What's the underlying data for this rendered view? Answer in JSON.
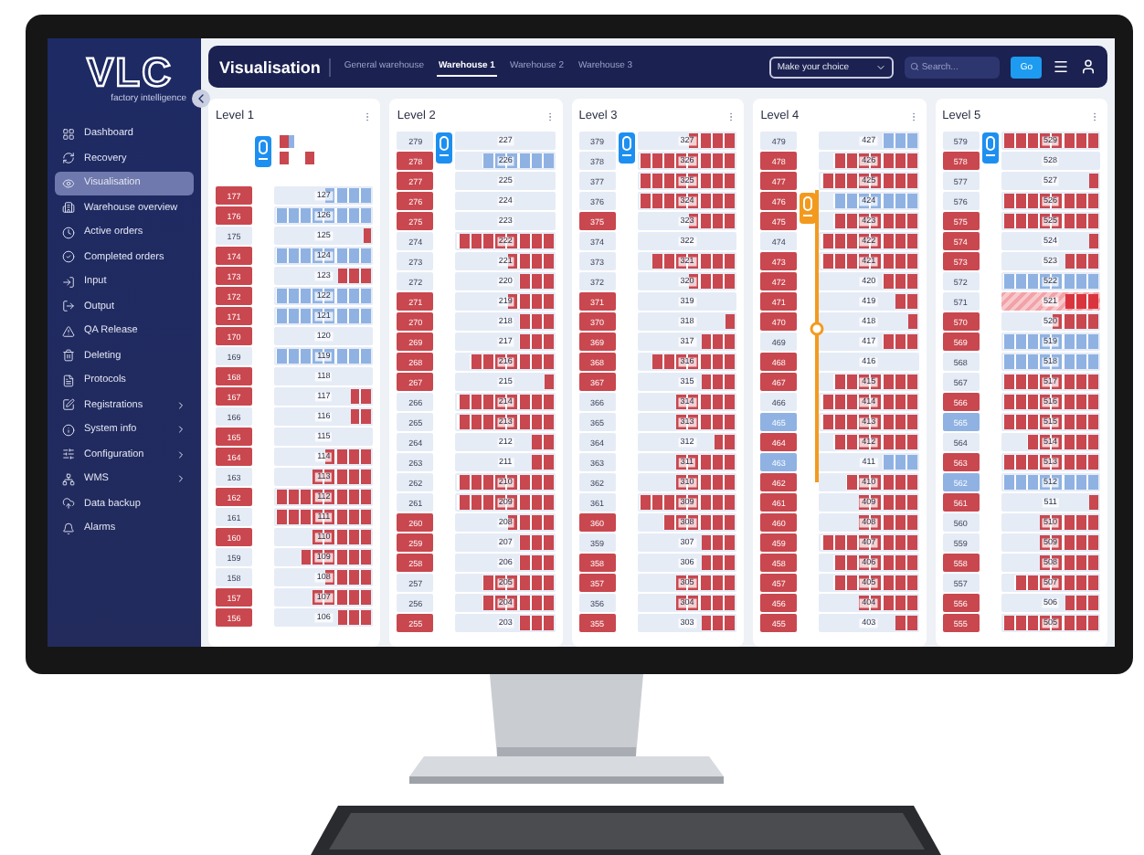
{
  "logo": {
    "name": "VLC",
    "tagline": "factory intelligence"
  },
  "sidebar": {
    "items": [
      {
        "label": "Dashboard",
        "selected": false,
        "submenu": false
      },
      {
        "label": "Recovery",
        "selected": false,
        "submenu": false
      },
      {
        "label": "Visualisation",
        "selected": true,
        "submenu": false
      },
      {
        "label": "Warehouse overview",
        "selected": false,
        "submenu": false
      },
      {
        "label": "Active orders",
        "selected": false,
        "submenu": false
      },
      {
        "label": "Completed orders",
        "selected": false,
        "submenu": false
      },
      {
        "label": "Input",
        "selected": false,
        "submenu": false
      },
      {
        "label": "Output",
        "selected": false,
        "submenu": false
      },
      {
        "label": "QA Release",
        "selected": false,
        "submenu": false
      },
      {
        "label": "Deleting",
        "selected": false,
        "submenu": false
      },
      {
        "label": "Protocols",
        "selected": false,
        "submenu": false
      },
      {
        "label": "Registrations",
        "selected": false,
        "submenu": true
      },
      {
        "label": "System info",
        "selected": false,
        "submenu": true
      },
      {
        "label": "Configuration",
        "selected": false,
        "submenu": true
      },
      {
        "label": "WMS",
        "selected": false,
        "submenu": true
      },
      {
        "label": "Data backup",
        "selected": false,
        "submenu": false
      },
      {
        "label": "Alarms",
        "selected": false,
        "submenu": false
      }
    ]
  },
  "header": {
    "title": "Visualisation",
    "tabs": [
      {
        "label": "General warehouse",
        "selected": false
      },
      {
        "label": "Warehouse 1",
        "selected": true
      },
      {
        "label": "Warehouse 2",
        "selected": false
      },
      {
        "label": "Warehouse 3",
        "selected": false
      }
    ],
    "select": {
      "placeholder": "Make your choice"
    },
    "search": {
      "placeholder": "Search..."
    },
    "go": "Go"
  },
  "levels": [
    {
      "title": "Level 1",
      "buffer": true,
      "lift": {
        "color": "#1d8ff0"
      },
      "track": false,
      "rows": [
        {
          "side": {
            "label": "177",
            "color": "#c9474f"
          },
          "bay": "127",
          "color": "#8fb2e3",
          "level": 0.5
        },
        {
          "side": {
            "label": "176",
            "color": "#c9474f"
          },
          "bay": "126",
          "color": "#8fb2e3",
          "level": 1
        },
        {
          "side": {
            "label": "175"
          },
          "bay": "125",
          "color": "#c9474f",
          "level": 0.125
        },
        {
          "side": {
            "label": "174",
            "color": "#c9474f"
          },
          "bay": "124",
          "color": "#8fb2e3",
          "level": 1
        },
        {
          "side": {
            "label": "173",
            "color": "#c9474f"
          },
          "bay": "123",
          "color": "#c9474f",
          "level": 0.375
        },
        {
          "side": {
            "label": "172",
            "color": "#c9474f"
          },
          "bay": "122",
          "color": "#8fb2e3",
          "level": 1
        },
        {
          "side": {
            "label": "171",
            "color": "#c9474f"
          },
          "bay": "121",
          "color": "#8fb2e3",
          "level": 1
        },
        {
          "side": {
            "label": "170",
            "color": "#c9474f"
          },
          "bay": "120"
        },
        {
          "side": {
            "label": "169"
          },
          "bay": "119",
          "color": "#8fb2e3",
          "level": 1
        },
        {
          "side": {
            "label": "168",
            "color": "#c9474f"
          },
          "bay": "118"
        },
        {
          "side": {
            "label": "167",
            "color": "#c9474f"
          },
          "bay": "117",
          "color": "#c9474f",
          "level": 0.25
        },
        {
          "side": {
            "label": "166"
          },
          "bay": "116",
          "color": "#c9474f",
          "level": 0.25
        },
        {
          "side": {
            "label": "165",
            "color": "#c9474f"
          },
          "bay": "115"
        },
        {
          "side": {
            "label": "164",
            "color": "#c9474f"
          },
          "bay": "114",
          "color": "#c9474f",
          "level": 0.5
        },
        {
          "side": {
            "label": "163"
          },
          "bay": "113",
          "color": "#c9474f",
          "level": 0.625
        },
        {
          "side": {
            "label": "162",
            "color": "#c9474f"
          },
          "bay": "112",
          "color": "#c9474f",
          "level": 1
        },
        {
          "side": {
            "label": "161"
          },
          "bay": "111",
          "color": "#c9474f",
          "level": 1
        },
        {
          "side": {
            "label": "160",
            "color": "#c9474f"
          },
          "bay": "110",
          "color": "#c9474f",
          "level": 0.625
        },
        {
          "side": {
            "label": "159"
          },
          "bay": "109",
          "color": "#c9474f",
          "level": 0.75
        },
        {
          "side": {
            "label": "158"
          },
          "bay": "108",
          "color": "#c9474f",
          "level": 0.5
        },
        {
          "side": {
            "label": "157",
            "color": "#c9474f"
          },
          "bay": "107",
          "color": "#c9474f",
          "level": 0.625
        },
        {
          "side": {
            "label": "156",
            "color": "#c9474f"
          },
          "bay": "106",
          "color": "#c9474f",
          "level": 0.375
        }
      ]
    },
    {
      "title": "Level 2",
      "buffer": false,
      "track": false,
      "rows": [
        {
          "side": {
            "label": "279"
          },
          "bay": "227",
          "lift": {
            "color": "#1d8ff0"
          }
        },
        {
          "side": {
            "label": "278",
            "color": "#c9474f"
          },
          "bay": "226",
          "color": "#8fb2e3",
          "level": 0.75
        },
        {
          "side": {
            "label": "277",
            "color": "#c9474f"
          },
          "bay": "225"
        },
        {
          "side": {
            "label": "276",
            "color": "#c9474f"
          },
          "bay": "224"
        },
        {
          "side": {
            "label": "275",
            "color": "#c9474f"
          },
          "bay": "223"
        },
        {
          "side": {
            "label": "274"
          },
          "bay": "222",
          "color": "#c9474f",
          "level": 1
        },
        {
          "side": {
            "label": "273"
          },
          "bay": "221",
          "color": "#c9474f",
          "level": 0.5
        },
        {
          "side": {
            "label": "272"
          },
          "bay": "220",
          "color": "#c9474f",
          "level": 0.375
        },
        {
          "side": {
            "label": "271",
            "color": "#c9474f"
          },
          "bay": "219",
          "color": "#c9474f",
          "level": 0.5
        },
        {
          "side": {
            "label": "270",
            "color": "#c9474f"
          },
          "bay": "218",
          "color": "#c9474f",
          "level": 0.375
        },
        {
          "side": {
            "label": "269",
            "color": "#c9474f"
          },
          "bay": "217",
          "color": "#c9474f",
          "level": 0.375
        },
        {
          "side": {
            "label": "268",
            "color": "#c9474f"
          },
          "bay": "216",
          "color": "#c9474f",
          "level": 0.875
        },
        {
          "side": {
            "label": "267",
            "color": "#c9474f"
          },
          "bay": "215",
          "color": "#c9474f",
          "level": 0.125
        },
        {
          "side": {
            "label": "266"
          },
          "bay": "214",
          "color": "#c9474f",
          "level": 1
        },
        {
          "side": {
            "label": "265"
          },
          "bay": "213",
          "color": "#c9474f",
          "level": 1
        },
        {
          "side": {
            "label": "264"
          },
          "bay": "212",
          "color": "#c9474f",
          "level": 0.25
        },
        {
          "side": {
            "label": "263"
          },
          "bay": "211",
          "color": "#c9474f",
          "level": 0.25
        },
        {
          "side": {
            "label": "262"
          },
          "bay": "210",
          "color": "#c9474f",
          "level": 1
        },
        {
          "side": {
            "label": "261"
          },
          "bay": "209",
          "color": "#c9474f",
          "level": 1
        },
        {
          "side": {
            "label": "260",
            "color": "#c9474f"
          },
          "bay": "208",
          "color": "#c9474f",
          "level": 0.5
        },
        {
          "side": {
            "label": "259",
            "color": "#c9474f"
          },
          "bay": "207",
          "color": "#c9474f",
          "level": 0.375
        },
        {
          "side": {
            "label": "258",
            "color": "#c9474f"
          },
          "bay": "206",
          "color": "#c9474f",
          "level": 0.375
        },
        {
          "side": {
            "label": "257"
          },
          "bay": "205",
          "color": "#c9474f",
          "level": 0.75
        },
        {
          "side": {
            "label": "256"
          },
          "bay": "204",
          "color": "#c9474f",
          "level": 0.75
        },
        {
          "side": {
            "label": "255",
            "color": "#c9474f"
          },
          "bay": "203",
          "color": "#c9474f",
          "level": 0.375
        }
      ]
    },
    {
      "title": "Level 3",
      "buffer": false,
      "track": false,
      "rows": [
        {
          "side": {
            "label": "379"
          },
          "bay": "327",
          "color": "#c9474f",
          "level": 0.5,
          "lift": {
            "color": "#1d8ff0"
          }
        },
        {
          "side": {
            "label": "378"
          },
          "bay": "326",
          "color": "#c9474f",
          "level": 1
        },
        {
          "side": {
            "label": "377"
          },
          "bay": "325",
          "color": "#c9474f",
          "level": 1
        },
        {
          "side": {
            "label": "376"
          },
          "bay": "324",
          "color": "#c9474f",
          "level": 1
        },
        {
          "side": {
            "label": "375",
            "color": "#c9474f"
          },
          "bay": "323",
          "color": "#c9474f",
          "level": 0.5
        },
        {
          "side": {
            "label": "374"
          },
          "bay": "322"
        },
        {
          "side": {
            "label": "373"
          },
          "bay": "321",
          "color": "#c9474f",
          "level": 0.875
        },
        {
          "side": {
            "label": "372"
          },
          "bay": "320",
          "color": "#c9474f",
          "level": 0.5
        },
        {
          "side": {
            "label": "371",
            "color": "#c9474f"
          },
          "bay": "319"
        },
        {
          "side": {
            "label": "370",
            "color": "#c9474f"
          },
          "bay": "318",
          "color": "#c9474f",
          "level": 0.125
        },
        {
          "side": {
            "label": "369",
            "color": "#c9474f"
          },
          "bay": "317",
          "color": "#c9474f",
          "level": 0.375
        },
        {
          "side": {
            "label": "368",
            "color": "#c9474f"
          },
          "bay": "316",
          "color": "#c9474f",
          "level": 0.875
        },
        {
          "side": {
            "label": "367",
            "color": "#c9474f"
          },
          "bay": "315",
          "color": "#c9474f",
          "level": 0.375
        },
        {
          "side": {
            "label": "366"
          },
          "bay": "314",
          "color": "#c9474f",
          "level": 0.625
        },
        {
          "side": {
            "label": "365"
          },
          "bay": "313",
          "color": "#c9474f",
          "level": 0.625
        },
        {
          "side": {
            "label": "364"
          },
          "bay": "312",
          "color": "#c9474f",
          "level": 0.25
        },
        {
          "side": {
            "label": "363"
          },
          "bay": "311",
          "color": "#c9474f",
          "level": 0.625
        },
        {
          "side": {
            "label": "362"
          },
          "bay": "310",
          "color": "#c9474f",
          "level": 0.625
        },
        {
          "side": {
            "label": "361"
          },
          "bay": "309",
          "color": "#c9474f",
          "level": 1
        },
        {
          "side": {
            "label": "360",
            "color": "#c9474f"
          },
          "bay": "308",
          "color": "#c9474f",
          "level": 0.75
        },
        {
          "side": {
            "label": "359"
          },
          "bay": "307",
          "color": "#c9474f",
          "level": 0.375
        },
        {
          "side": {
            "label": "358",
            "color": "#c9474f"
          },
          "bay": "306",
          "color": "#c9474f",
          "level": 0.375
        },
        {
          "side": {
            "label": "357",
            "color": "#c9474f"
          },
          "bay": "305",
          "color": "#c9474f",
          "level": 0.625
        },
        {
          "side": {
            "label": "356"
          },
          "bay": "304",
          "color": "#c9474f",
          "level": 0.625
        },
        {
          "side": {
            "label": "355",
            "color": "#c9474f"
          },
          "bay": "303",
          "color": "#c9474f",
          "level": 0.375
        }
      ]
    },
    {
      "title": "Level 4",
      "buffer": false,
      "track": true,
      "rows": [
        {
          "side": {
            "label": "479"
          },
          "bay": "427",
          "color": "#8fb2e3",
          "level": 0.375
        },
        {
          "side": {
            "label": "478",
            "color": "#c9474f"
          },
          "bay": "426",
          "color": "#c9474f",
          "level": 0.875
        },
        {
          "side": {
            "label": "477",
            "color": "#c9474f"
          },
          "bay": "425",
          "color": "#c9474f",
          "level": 1
        },
        {
          "side": {
            "label": "476",
            "color": "#c9474f"
          },
          "bay": "424",
          "color": "#8fb2e3",
          "level": 0.875,
          "lift": {
            "color": "#f39a1e"
          }
        },
        {
          "side": {
            "label": "475",
            "color": "#c9474f"
          },
          "bay": "423",
          "color": "#c9474f",
          "level": 0.875
        },
        {
          "side": {
            "label": "474"
          },
          "bay": "422",
          "color": "#c9474f",
          "level": 1
        },
        {
          "side": {
            "label": "473",
            "color": "#c9474f"
          },
          "bay": "421",
          "color": "#c9474f",
          "level": 1
        },
        {
          "side": {
            "label": "472",
            "color": "#c9474f"
          },
          "bay": "420",
          "color": "#c9474f",
          "level": 0.375
        },
        {
          "side": {
            "label": "471",
            "color": "#c9474f"
          },
          "bay": "419",
          "color": "#c9474f",
          "level": 0.25
        },
        {
          "side": {
            "label": "470",
            "color": "#c9474f"
          },
          "bay": "418",
          "color": "#c9474f",
          "level": 0.125
        },
        {
          "side": {
            "label": "469"
          },
          "bay": "417",
          "color": "#c9474f",
          "level": 0.375
        },
        {
          "side": {
            "label": "468",
            "color": "#c9474f"
          },
          "bay": "416"
        },
        {
          "side": {
            "label": "467",
            "color": "#c9474f"
          },
          "bay": "415",
          "color": "#c9474f",
          "level": 0.875
        },
        {
          "side": {
            "label": "466"
          },
          "bay": "414",
          "color": "#c9474f",
          "level": 1
        },
        {
          "side": {
            "label": "465",
            "color": "#8fb2e3"
          },
          "bay": "413",
          "color": "#c9474f",
          "level": 1
        },
        {
          "side": {
            "label": "464",
            "color": "#c9474f"
          },
          "bay": "412",
          "color": "#c9474f",
          "level": 0.875
        },
        {
          "side": {
            "label": "463",
            "color": "#8fb2e3"
          },
          "bay": "411",
          "color": "#8fb2e3",
          "level": 0.375
        },
        {
          "side": {
            "label": "462",
            "color": "#c9474f"
          },
          "bay": "410",
          "color": "#c9474f",
          "level": 0.75
        },
        {
          "side": {
            "label": "461",
            "color": "#c9474f"
          },
          "bay": "409",
          "color": "#c9474f",
          "level": 0.625
        },
        {
          "side": {
            "label": "460",
            "color": "#c9474f"
          },
          "bay": "408",
          "color": "#c9474f",
          "level": 0.625
        },
        {
          "side": {
            "label": "459",
            "color": "#c9474f"
          },
          "bay": "407",
          "color": "#c9474f",
          "level": 1
        },
        {
          "side": {
            "label": "458",
            "color": "#c9474f"
          },
          "bay": "406",
          "color": "#c9474f",
          "level": 0.875
        },
        {
          "side": {
            "label": "457",
            "color": "#c9474f"
          },
          "bay": "405",
          "color": "#c9474f",
          "level": 0.875
        },
        {
          "side": {
            "label": "456",
            "color": "#c9474f"
          },
          "bay": "404",
          "color": "#c9474f",
          "level": 0.625
        },
        {
          "side": {
            "label": "455",
            "color": "#c9474f"
          },
          "bay": "403",
          "color": "#c9474f",
          "level": 0.25
        }
      ]
    },
    {
      "title": "Level 5",
      "buffer": false,
      "track": false,
      "rows": [
        {
          "side": {
            "label": "579"
          },
          "bay": "529",
          "color": "#c9474f",
          "level": 1,
          "lift": {
            "color": "#1d8ff0"
          }
        },
        {
          "side": {
            "label": "578",
            "color": "#c9474f"
          },
          "bay": "528"
        },
        {
          "side": {
            "label": "577"
          },
          "bay": "527",
          "color": "#c9474f",
          "level": 0.125
        },
        {
          "side": {
            "label": "576"
          },
          "bay": "526",
          "color": "#c9474f",
          "level": 1
        },
        {
          "side": {
            "label": "575",
            "color": "#c9474f"
          },
          "bay": "525",
          "color": "#c9474f",
          "level": 1
        },
        {
          "side": {
            "label": "574",
            "color": "#c9474f"
          },
          "bay": "524",
          "color": "#c9474f",
          "level": 0.125
        },
        {
          "side": {
            "label": "573",
            "color": "#c9474f"
          },
          "bay": "523",
          "color": "#c9474f",
          "level": 0.375
        },
        {
          "side": {
            "label": "572"
          },
          "bay": "522",
          "color": "#8fb2e3",
          "level": 1
        },
        {
          "side": {
            "label": "571"
          },
          "bay": "521",
          "color": "#d9353f",
          "level": 0.375,
          "alert": true
        },
        {
          "side": {
            "label": "570",
            "color": "#c9474f"
          },
          "bay": "520",
          "color": "#c9474f",
          "level": 0.5
        },
        {
          "side": {
            "label": "569",
            "color": "#c9474f"
          },
          "bay": "519",
          "color": "#8fb2e3",
          "level": 1
        },
        {
          "side": {
            "label": "568"
          },
          "bay": "518",
          "color": "#8fb2e3",
          "level": 1
        },
        {
          "side": {
            "label": "567"
          },
          "bay": "517",
          "color": "#c9474f",
          "level": 1
        },
        {
          "side": {
            "label": "566",
            "color": "#c9474f"
          },
          "bay": "516",
          "color": "#c9474f",
          "level": 1
        },
        {
          "side": {
            "label": "565",
            "color": "#8fb2e3"
          },
          "bay": "515",
          "color": "#c9474f",
          "level": 1
        },
        {
          "side": {
            "label": "564"
          },
          "bay": "514",
          "color": "#c9474f",
          "level": 0.75
        },
        {
          "side": {
            "label": "563",
            "color": "#c9474f"
          },
          "bay": "513",
          "color": "#c9474f",
          "level": 1
        },
        {
          "side": {
            "label": "562",
            "color": "#8fb2e3"
          },
          "bay": "512",
          "color": "#8fb2e3",
          "level": 1
        },
        {
          "side": {
            "label": "561",
            "color": "#c9474f"
          },
          "bay": "511",
          "color": "#c9474f",
          "level": 0.125
        },
        {
          "side": {
            "label": "560"
          },
          "bay": "510",
          "color": "#c9474f",
          "level": 0.625
        },
        {
          "side": {
            "label": "559"
          },
          "bay": "509",
          "color": "#c9474f",
          "level": 0.625
        },
        {
          "side": {
            "label": "558",
            "color": "#c9474f"
          },
          "bay": "508",
          "color": "#c9474f",
          "level": 0.625
        },
        {
          "side": {
            "label": "557"
          },
          "bay": "507",
          "color": "#c9474f",
          "level": 0.875
        },
        {
          "side": {
            "label": "556",
            "color": "#c9474f"
          },
          "bay": "506",
          "color": "#c9474f",
          "level": 0.375
        },
        {
          "side": {
            "label": "555",
            "color": "#c9474f"
          },
          "bay": "505",
          "color": "#c9474f",
          "level": 1
        }
      ]
    }
  ]
}
